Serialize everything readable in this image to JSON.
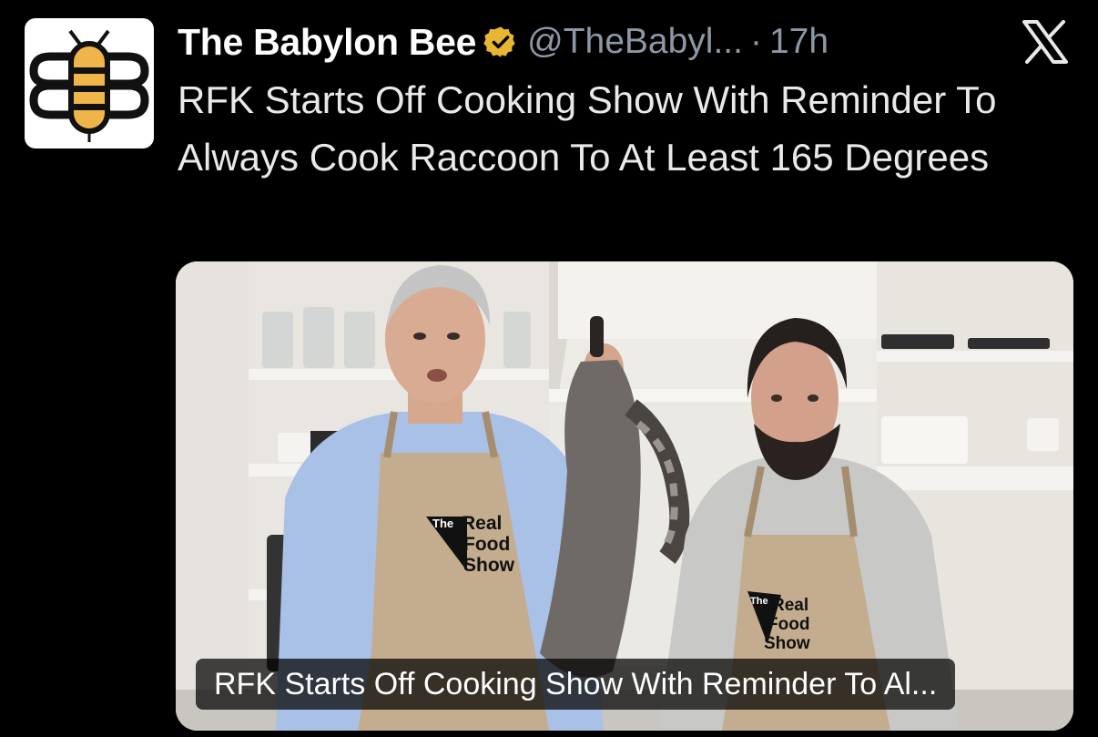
{
  "post": {
    "author_name": "The Babylon Bee",
    "handle": "@TheBabyl...",
    "separator": "·",
    "time": "17h",
    "text": "RFK Starts Off Cooking Show With Reminder To Always Cook Raccoon To At Least 165 Degrees"
  },
  "media": {
    "caption": "RFK Starts Off Cooking Show With Reminder To Al...",
    "apron_brand": {
      "line1": "The",
      "line2": "Real",
      "line3": "Food",
      "line4": "Show"
    }
  },
  "colors": {
    "background": "#000000",
    "verified_badge": "#e8b631",
    "accent_gold": "#f0b54a"
  },
  "icons": {
    "verified": "verified-badge-icon",
    "platform": "x-logo-icon",
    "avatar": "bee-logo"
  }
}
